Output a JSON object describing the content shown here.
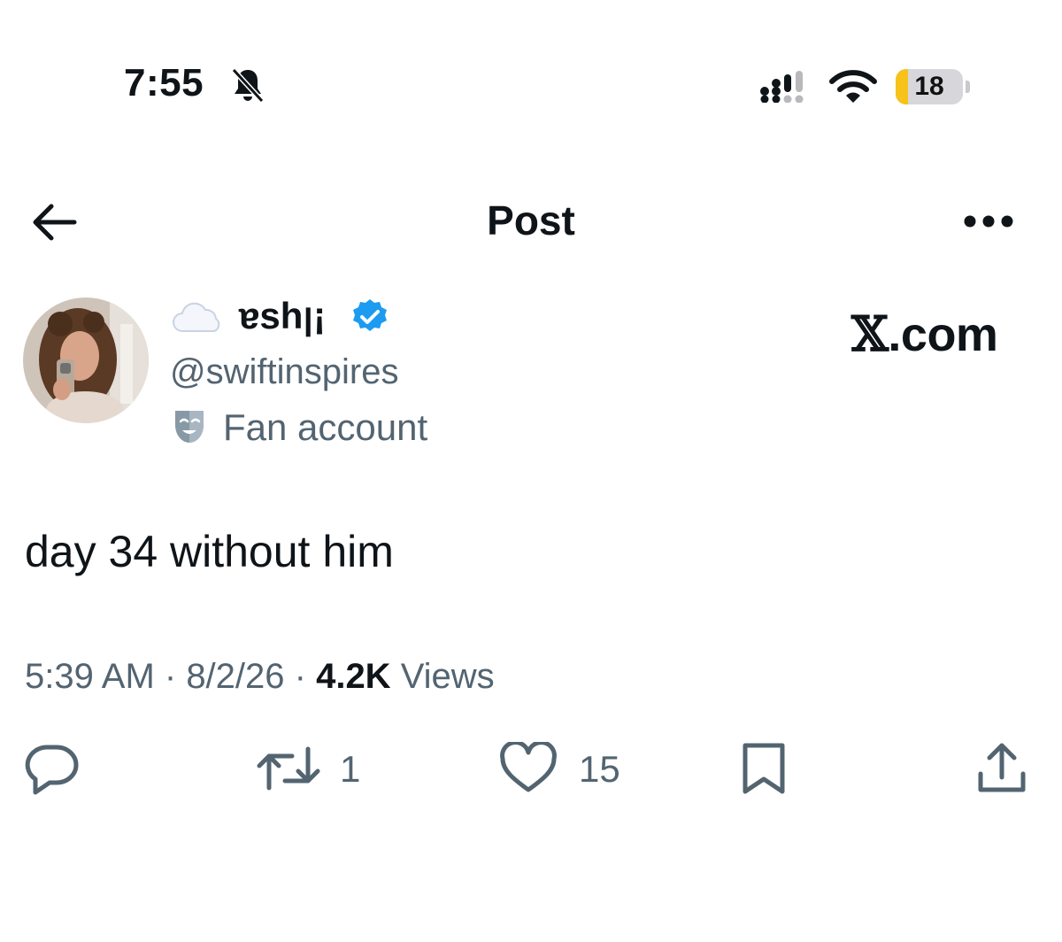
{
  "status_bar": {
    "time": "7:55",
    "battery": "18",
    "battery_level_percent": 18,
    "icons": [
      "bell-slash-icon",
      "cellular-signal-icon",
      "wifi-icon",
      "battery-icon"
    ]
  },
  "header": {
    "title": "Post",
    "icons": [
      "arrow-left-icon",
      "more-horizontal-icon"
    ]
  },
  "author": {
    "display_name": "ɐshꞁ¡",
    "handle": "@swiftinspires",
    "label": "Fan account",
    "icons": [
      "cloud-emoji-icon",
      "verified-badge-icon",
      "theater-mask-icon",
      "avatar-photo"
    ]
  },
  "watermark": {
    "text": ".com"
  },
  "post": {
    "text": "day 34 without him"
  },
  "meta": {
    "time": "5:39 AM",
    "sep": " · ",
    "date": "8/2/26",
    "views_count": "4.2K",
    "views_label": " Views"
  },
  "actions": {
    "reposts": "1",
    "likes": "15",
    "icons": [
      "reply-icon",
      "repost-icon",
      "heart-icon",
      "bookmark-icon",
      "share-icon"
    ]
  },
  "colors": {
    "text_primary": "#0f1419",
    "text_secondary": "#536471",
    "verified": "#1d9bf0",
    "battery_fill": "#f7c21a"
  }
}
